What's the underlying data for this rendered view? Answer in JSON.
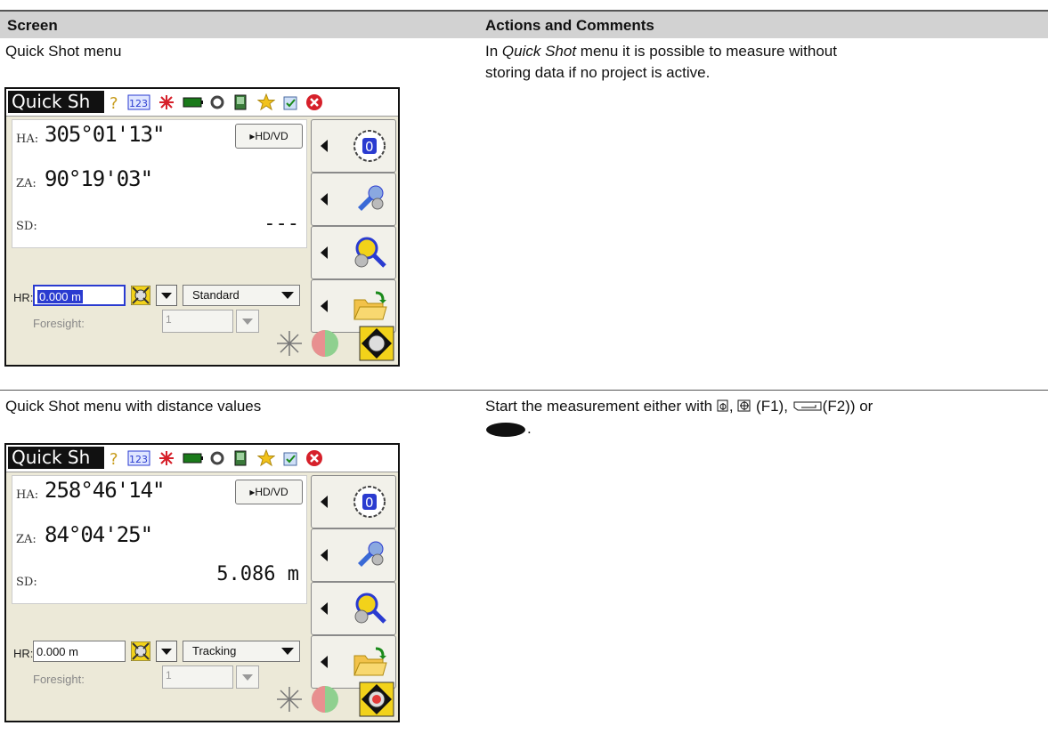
{
  "table": {
    "col_screen": "Screen",
    "col_actions": "Actions and Comments",
    "rows": [
      {
        "screen_caption": "Quick Shot menu",
        "comment_pre": "In ",
        "comment_em": "Quick Shot",
        "comment_post": " menu it is possible to measure without storing data if no project is active."
      },
      {
        "screen_caption": "Quick Shot menu with distance values",
        "comment_text": "Start the measurement either with",
        "comment_f1": "(F1),",
        "comment_f2": "(F2)) or"
      }
    ]
  },
  "screens": [
    {
      "title": "Quick Sh",
      "ha_label": "HA:",
      "ha_value": "305°01'13\"",
      "za_label": "ZA:",
      "za_value": "90°19'03\"",
      "sd_label": "SD:",
      "sd_value": "---",
      "hdvd_label": "▸HD/VD",
      "hr_label": "HR:",
      "hr_value": "0.000 m",
      "mode_value": "Standard",
      "foresight_label": "Foresight:",
      "foresight_value": "1"
    },
    {
      "title": "Quick Sh",
      "ha_label": "HA:",
      "ha_value": "258°46'14\"",
      "za_label": "ZA:",
      "za_value": "84°04'25\"",
      "sd_label": "SD:",
      "sd_value": "5.086 m",
      "hdvd_label": "▸HD/VD",
      "hr_label": "HR:",
      "hr_value": "0.000 m",
      "mode_value": "Tracking",
      "foresight_label": "Foresight:",
      "foresight_value": "1"
    }
  ],
  "icons": {
    "help": "question-icon",
    "keypad": "123-icon",
    "laser": "laser-icon",
    "battery": "battery-icon",
    "settings": "settings-icon",
    "device": "device-icon",
    "favorite": "star-icon",
    "clipboard": "clipboard-icon",
    "close": "close-icon"
  },
  "colors": {
    "header_bg": "#d2d2d2",
    "screen_bg": "#ece9d8",
    "selection": "#2a3bd0",
    "close_red": "#d6202a"
  }
}
